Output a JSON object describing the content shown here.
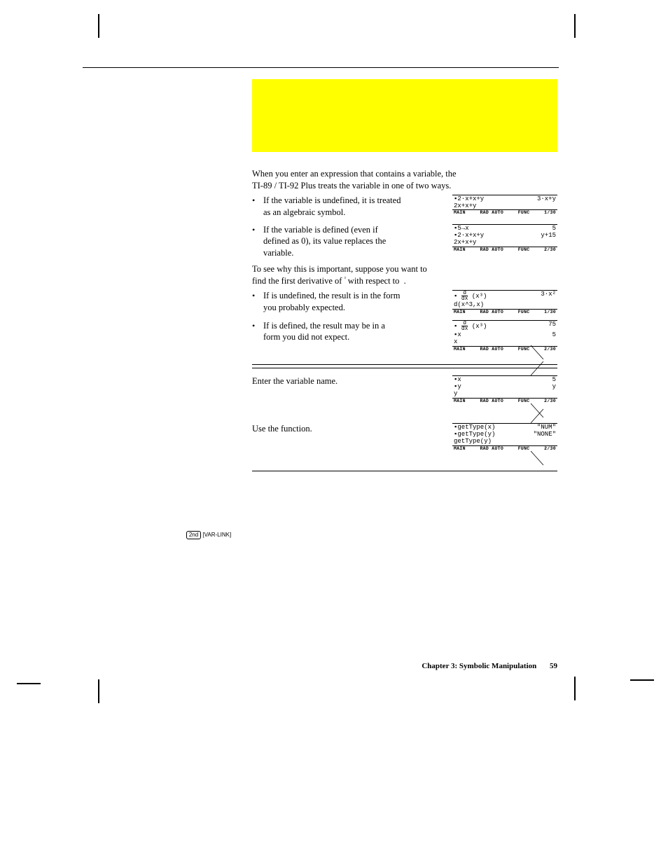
{
  "intro": "When you enter an expression that contains a variable, the TI-89 / TI-92 Plus treats the variable in one of two ways.",
  "b1": "If the variable is undefined, it is treated as an algebraic symbol.",
  "b2": "If the variable is defined (even if defined as 0), its value replaces the variable.",
  "mid": "To see why this is important, suppose you want to find the first derivative of ",
  "mid_tail": " with respect to ",
  "mid_symbol": "³",
  "b3_a": "If ",
  "b3_b": " is undefined, the result is in the form you probably expected.",
  "b4_a": "If ",
  "b4_b": " is defined, the result may be in a form you did not expect.",
  "m1": "Enter the variable name.",
  "m2_a": "Use the ",
  "m2_b": " function.",
  "side_key": "2nd",
  "side_link": "[VAR-LINK]",
  "screens": {
    "s1": {
      "r1a": "▪2·x+x+y",
      "r1b": "3·x+y",
      "entry": "2x+x+y",
      "stat": [
        "MAIN",
        "RAD AUTO",
        "FUNC",
        "1/30"
      ]
    },
    "s2": {
      "r0a": "▪5→x",
      "r0b": "5",
      "r1a": "▪2·x+x+y",
      "r1b": "y+15",
      "entry": "2x+x+y",
      "stat": [
        "MAIN",
        "RAD AUTO",
        "FUNC",
        "2/30"
      ]
    },
    "s3": {
      "expr_left": "▪",
      "h_n": "d",
      "h_d": "dx",
      "h_tail": "(x³)",
      "r1b": "3·x²",
      "entry": "d(x^3,x)",
      "stat": [
        "MAIN",
        "RAD AUTO",
        "FUNC",
        "1/30"
      ]
    },
    "s4": {
      "r1b": "75",
      "r2a": "▪x",
      "r2b": "5",
      "entry": "x",
      "stat": [
        "MAIN",
        "RAD AUTO",
        "FUNC",
        "2/30"
      ]
    },
    "s5": {
      "r1a": "▪x",
      "r1b": "5",
      "r2a": "▪y",
      "r2b": "y",
      "entry": "y",
      "stat": [
        "MAIN",
        "RAD AUTO",
        "FUNC",
        "2/30"
      ]
    },
    "s6": {
      "r1a": "▪getType(x)",
      "r1b": "\"NUM\"",
      "r2a": "▪getType(y)",
      "r2b": "\"NONE\"",
      "entry": "getType(y)",
      "stat": [
        "MAIN",
        "RAD AUTO",
        "FUNC",
        "2/30"
      ]
    }
  },
  "footer_chapter": "Chapter 3: Symbolic Manipulation",
  "footer_page": "59"
}
